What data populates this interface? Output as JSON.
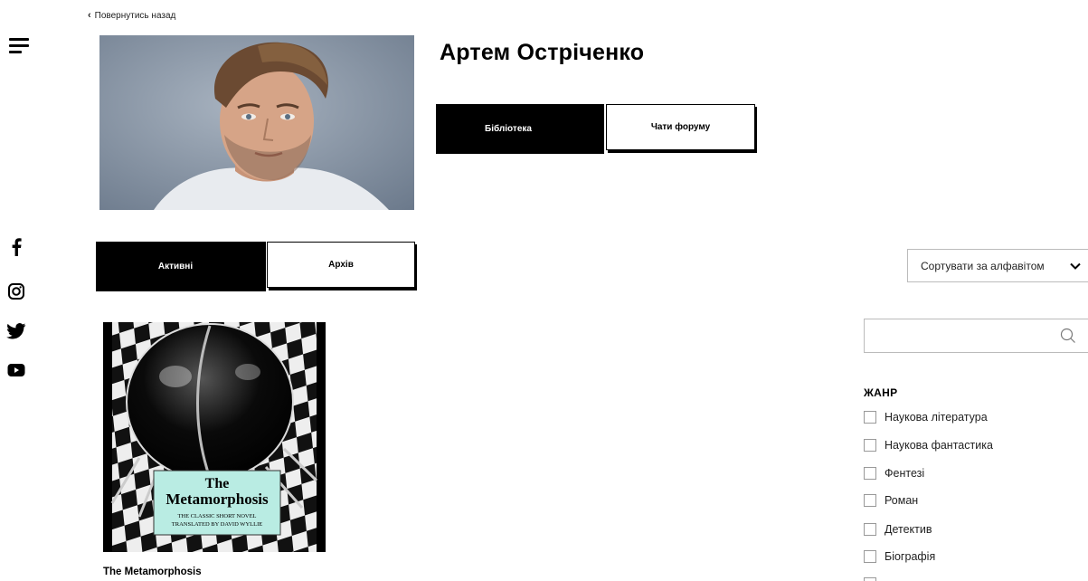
{
  "nav": {
    "back_label": "Повернутись назад"
  },
  "author": {
    "name": "Артем Острiченко"
  },
  "profile_tabs": {
    "library": "Бібліотека",
    "forum_chats": "Чати форуму"
  },
  "book_tabs": {
    "active": "Активні",
    "archive": "Архів"
  },
  "sort": {
    "label": "Сортувати за алфавітом"
  },
  "search": {
    "value": "",
    "placeholder": ""
  },
  "filters": {
    "genre_title": "ЖАНР",
    "genres": [
      "Наукова література",
      "Наукова фантастика",
      "Фентезі",
      "Роман",
      "Детектив",
      "Біографія"
    ]
  },
  "books": [
    {
      "title": "The Metamorphosis",
      "cover_title_line1": "The",
      "cover_title_line2": "Metamorphosis",
      "cover_sub1": "THE CLASSIC SHORT NOVEL",
      "cover_sub2": "TRANSLATED BY DAVID WYLLIE"
    }
  ],
  "icons": {
    "menu": "hamburger-menu-icon",
    "social": [
      "facebook-icon",
      "instagram-icon",
      "twitter-icon",
      "youtube-icon"
    ],
    "search": "search-icon",
    "sort": "chevron-down-icon",
    "back": "chevron-left-icon"
  }
}
